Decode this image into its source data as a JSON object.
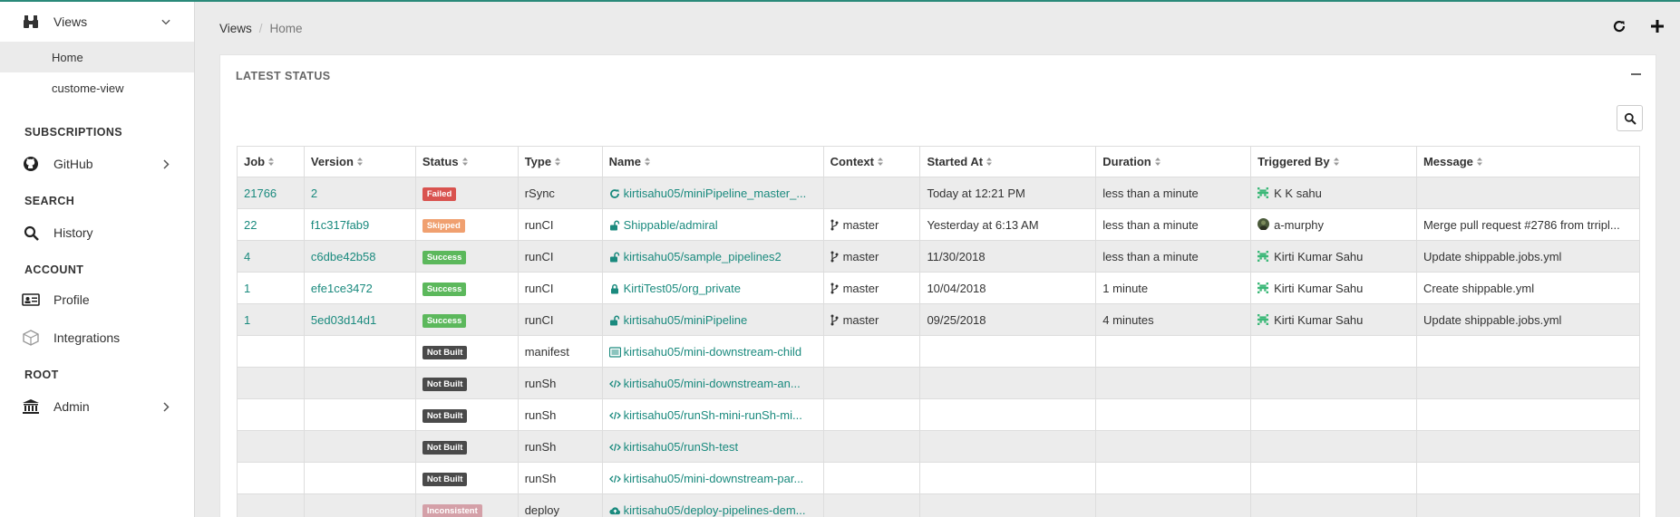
{
  "sidebar": {
    "views": {
      "label": "Views",
      "icon": "binoculars-icon"
    },
    "view_items": [
      {
        "label": "Home",
        "active": true
      },
      {
        "label": "custome-view",
        "active": false
      }
    ],
    "sections": {
      "subscriptions": "SUBSCRIPTIONS",
      "search": "SEARCH",
      "account": "ACCOUNT",
      "root": "ROOT"
    },
    "github": "GitHub",
    "history": "History",
    "profile": "Profile",
    "integrations": "Integrations",
    "admin": "Admin"
  },
  "breadcrumb": {
    "root": "Views",
    "sep": "/",
    "current": "Home"
  },
  "panel": {
    "title": "LATEST STATUS"
  },
  "table": {
    "headers": [
      "Job",
      "Version",
      "Status",
      "Type",
      "Name",
      "Context",
      "Started At",
      "Duration",
      "Triggered By",
      "Message"
    ],
    "rows": [
      {
        "job": "21766",
        "version": "2",
        "status": "Failed",
        "status_color": "#d9534f",
        "type": "rSync",
        "name_icon": "sync-icon",
        "name": "kirtisahu05/miniPipeline_master_...",
        "context": "",
        "started": "Today at 12:21 PM",
        "duration": "less than a minute",
        "trig_avatar": "identicon",
        "triggered": "K K sahu",
        "message": ""
      },
      {
        "job": "22",
        "version": "f1c317fab9",
        "status": "Skipped",
        "status_color": "#f0a070",
        "type": "runCI",
        "name_icon": "unlock-icon",
        "name": "Shippable/admiral",
        "context": "master",
        "started": "Yesterday at 6:13 AM",
        "duration": "less than a minute",
        "trig_avatar": "photo",
        "triggered": "a-murphy",
        "message": "Merge pull request #2786 from trripl..."
      },
      {
        "job": "4",
        "version": "c6dbe42b58",
        "status": "Success",
        "status_color": "#5cb85c",
        "type": "runCI",
        "name_icon": "unlock-icon",
        "name": "kirtisahu05/sample_pipelines2",
        "context": "master",
        "started": "11/30/2018",
        "duration": "less than a minute",
        "trig_avatar": "identicon",
        "triggered": "Kirti Kumar Sahu",
        "message": "Update shippable.jobs.yml"
      },
      {
        "job": "1",
        "version": "efe1ce3472",
        "status": "Success",
        "status_color": "#5cb85c",
        "type": "runCI",
        "name_icon": "lock-icon",
        "name": "KirtiTest05/org_private",
        "context": "master",
        "started": "10/04/2018",
        "duration": "1 minute",
        "trig_avatar": "identicon",
        "triggered": "Kirti Kumar Sahu",
        "message": "Create shippable.yml"
      },
      {
        "job": "1",
        "version": "5ed03d14d1",
        "status": "Success",
        "status_color": "#5cb85c",
        "type": "runCI",
        "name_icon": "unlock-icon",
        "name": "kirtisahu05/miniPipeline",
        "context": "master",
        "started": "09/25/2018",
        "duration": "4 minutes",
        "trig_avatar": "identicon",
        "triggered": "Kirti Kumar Sahu",
        "message": "Update shippable.jobs.yml"
      },
      {
        "job": "",
        "version": "",
        "status": "Not Built",
        "status_color": "#4a4a4a",
        "type": "manifest",
        "name_icon": "list-icon",
        "name": "kirtisahu05/mini-downstream-child",
        "context": "",
        "started": "",
        "duration": "",
        "trig_avatar": "",
        "triggered": "",
        "message": ""
      },
      {
        "job": "",
        "version": "",
        "status": "Not Built",
        "status_color": "#4a4a4a",
        "type": "runSh",
        "name_icon": "code-icon",
        "name": "kirtisahu05/mini-downstream-an...",
        "context": "",
        "started": "",
        "duration": "",
        "trig_avatar": "",
        "triggered": "",
        "message": ""
      },
      {
        "job": "",
        "version": "",
        "status": "Not Built",
        "status_color": "#4a4a4a",
        "type": "runSh",
        "name_icon": "code-icon",
        "name": "kirtisahu05/runSh-mini-runSh-mi...",
        "context": "",
        "started": "",
        "duration": "",
        "trig_avatar": "",
        "triggered": "",
        "message": ""
      },
      {
        "job": "",
        "version": "",
        "status": "Not Built",
        "status_color": "#4a4a4a",
        "type": "runSh",
        "name_icon": "code-icon",
        "name": "kirtisahu05/runSh-test",
        "context": "",
        "started": "",
        "duration": "",
        "trig_avatar": "",
        "triggered": "",
        "message": ""
      },
      {
        "job": "",
        "version": "",
        "status": "Not Built",
        "status_color": "#4a4a4a",
        "type": "runSh",
        "name_icon": "code-icon",
        "name": "kirtisahu05/mini-downstream-par...",
        "context": "",
        "started": "",
        "duration": "",
        "trig_avatar": "",
        "triggered": "",
        "message": ""
      },
      {
        "job": "",
        "version": "",
        "status": "Inconsistent",
        "status_color": "#d4a0a8",
        "type": "deploy",
        "name_icon": "cloud-upload-icon",
        "name": "kirtisahu05/deploy-pipelines-dem...",
        "context": "",
        "started": "",
        "duration": "",
        "trig_avatar": "",
        "triggered": "",
        "message": ""
      }
    ]
  }
}
